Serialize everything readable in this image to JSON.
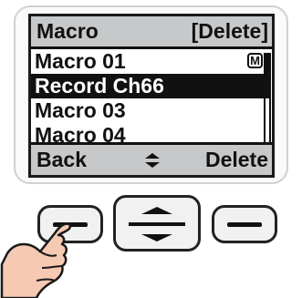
{
  "screen": {
    "title": "Macro",
    "header_action": "[Delete]",
    "items": [
      {
        "label": "Macro 01",
        "badge": "M",
        "selected": false
      },
      {
        "label": "Record Ch66",
        "badge": "",
        "selected": true
      },
      {
        "label": "Macro 03",
        "badge": "",
        "selected": false
      },
      {
        "label": "Macro 04",
        "badge": "",
        "selected": false
      }
    ],
    "softkeys": {
      "left": "Back",
      "middle_icon": "up-down-arrows-icon",
      "right": "Delete"
    },
    "scrollbar_position": 0.0
  },
  "colors": {
    "lcd_bar": "#c7c8ca",
    "ink": "#111111",
    "button_face": "#f1f1f1"
  }
}
